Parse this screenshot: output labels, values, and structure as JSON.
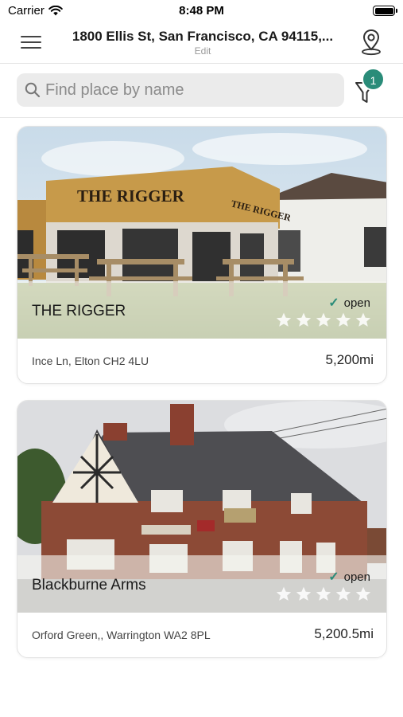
{
  "status_bar": {
    "carrier": "Carrier",
    "time": "8:48 PM"
  },
  "header": {
    "title": "1800 Ellis St, San Francisco, CA 94115,...",
    "subtitle": "Edit",
    "menu_icon": "hamburger-icon",
    "location_icon": "location-pin-icon"
  },
  "search": {
    "placeholder": "Find place by name",
    "value": "",
    "filter_icon": "filter-icon",
    "filter_badge": "1"
  },
  "colors": {
    "accent": "#2a8c79",
    "search_bg": "#ebebeb",
    "divider": "#e3e3e3"
  },
  "places": [
    {
      "name": "THE RIGGER",
      "status": "open",
      "rating": 0,
      "rating_max": 5,
      "address": "Ince Ln, Elton CH2 4LU",
      "distance": "5,200mi",
      "sign_text": "THE RIGGER"
    },
    {
      "name": "Blackburne Arms",
      "status": "open",
      "rating": 0,
      "rating_max": 5,
      "address": "Orford Green,, Warrington WA2 8PL",
      "distance": "5,200.5mi"
    }
  ]
}
